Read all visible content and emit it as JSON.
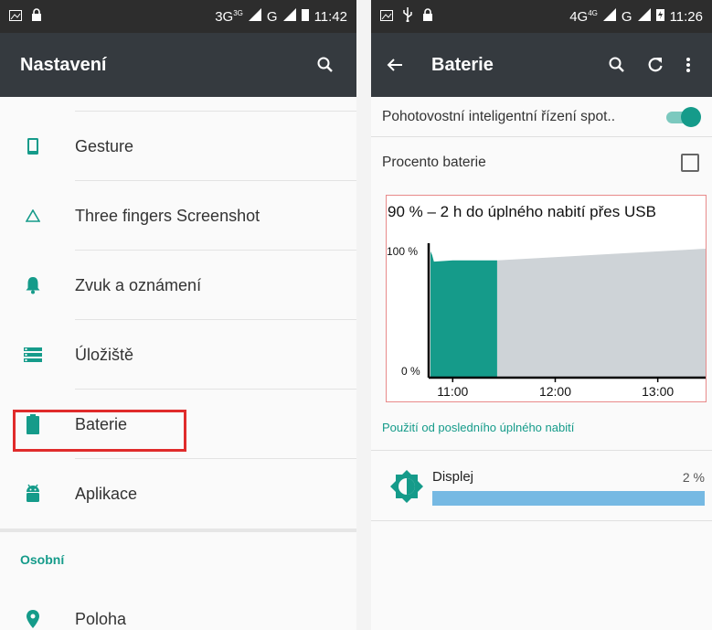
{
  "left": {
    "status": {
      "network": "3G",
      "network_sup": "3G",
      "network2": "G",
      "time": "11:42"
    },
    "toolbar": {
      "title": "Nastavení",
      "search_icon": "search-icon"
    },
    "items": [
      {
        "label": "Gesture",
        "icon": "phone-icon"
      },
      {
        "label": "Three fingers Screenshot",
        "icon": "triangle-icon"
      },
      {
        "label": "Zvuk a oznámení",
        "icon": "bell-icon"
      },
      {
        "label": "Úložiště",
        "icon": "storage-icon"
      },
      {
        "label": "Baterie",
        "icon": "battery-icon"
      },
      {
        "label": "Aplikace",
        "icon": "android-icon"
      }
    ],
    "section": "Osobní",
    "items2": [
      {
        "label": "Poloha",
        "icon": "location-pin-icon"
      }
    ]
  },
  "right": {
    "status": {
      "network": "4G",
      "network_sup": "4G",
      "network2": "G",
      "time": "11:26"
    },
    "toolbar": {
      "title": "Baterie"
    },
    "smart_standby": {
      "label": "Pohotovostní inteligentní řízení spot..",
      "on": true
    },
    "battery_percent": {
      "label": "Procento baterie",
      "checked": false
    },
    "chart_data": {
      "type": "area",
      "title": "90 % – 2 h do úplného nabití přes USB",
      "y_ticks": [
        "100 %",
        "0 %"
      ],
      "ylim": [
        0,
        100
      ],
      "x_ticks": [
        "11:00",
        "12:00",
        "13:00"
      ],
      "series": [
        {
          "x": [
            "10:47",
            "10:48",
            "10:49",
            "11:00",
            "11:26"
          ],
          "values": [
            98,
            95,
            90,
            91,
            91
          ],
          "color": "#159b8a"
        },
        {
          "x": [
            "11:26",
            "13:28"
          ],
          "values": [
            91,
            100
          ],
          "color": "#ced3d7"
        }
      ]
    },
    "usage_link": "Použití od posledního úplného nabití",
    "usage": [
      {
        "label": "Displej",
        "percent": "2 %",
        "icon": "brightness-icon",
        "bar_color": "#76b9e3"
      }
    ]
  },
  "colors": {
    "accent": "#159b8a",
    "toolbar": "#353a3f",
    "statusbar": "#2d2d2d",
    "highlight": "#e02b2b"
  }
}
